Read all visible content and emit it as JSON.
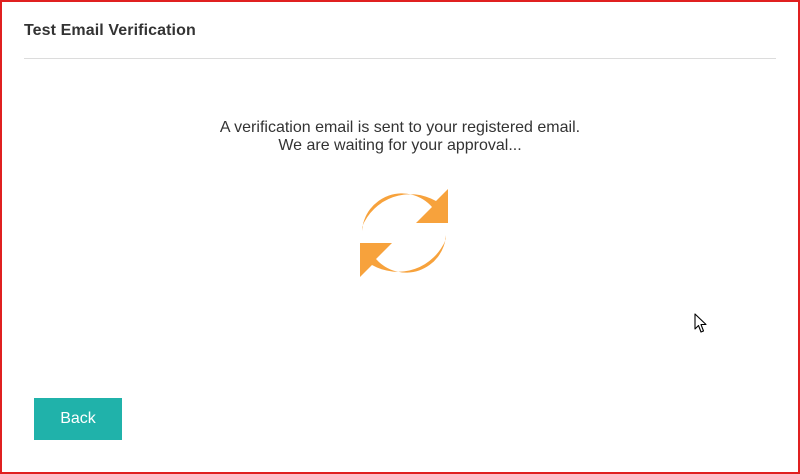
{
  "dialog": {
    "title": "Test Email Verification"
  },
  "message": {
    "line1": "A verification email is sent to your registered email.",
    "line2": "We are waiting for your approval..."
  },
  "status_icon": {
    "name": "refresh-icon",
    "color": "#f7a23c"
  },
  "actions": {
    "back_label": "Back"
  },
  "colors": {
    "frame_border": "#e02020",
    "button_bg": "#20b2aa"
  }
}
